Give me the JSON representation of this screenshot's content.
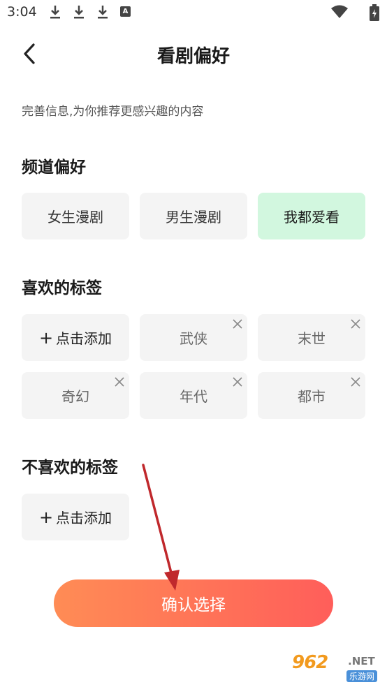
{
  "status_bar": {
    "time": "3:04",
    "download_icons": [
      "download-icon",
      "download-icon",
      "download-icon"
    ],
    "notification_badge": "A",
    "wifi_icon": "wifi-icon",
    "battery_icon": "battery-icon"
  },
  "header": {
    "back_icon": "chevron-left-icon",
    "title": "看剧偏好"
  },
  "subtitle": "完善信息,为你推荐更感兴趣的内容",
  "channel_section": {
    "title": "频道偏好",
    "options": [
      {
        "label": "女生漫剧",
        "selected": false
      },
      {
        "label": "男生漫剧",
        "selected": false
      },
      {
        "label": "我都爱看",
        "selected": true
      }
    ],
    "selected_color": "#d2f7df"
  },
  "liked_section": {
    "title": "喜欢的标签",
    "add_label": "点击添加",
    "tags": [
      "武侠",
      "末世",
      "奇幻",
      "年代",
      "都市"
    ]
  },
  "disliked_section": {
    "title": "不喜欢的标签",
    "add_label": "点击添加"
  },
  "confirm_button": {
    "label": "确认选择",
    "gradient": [
      "#ff8c55",
      "#ff5e5a"
    ]
  },
  "watermark": {
    "main": "962",
    "suffix": ".NET",
    "sub": "乐游网"
  }
}
